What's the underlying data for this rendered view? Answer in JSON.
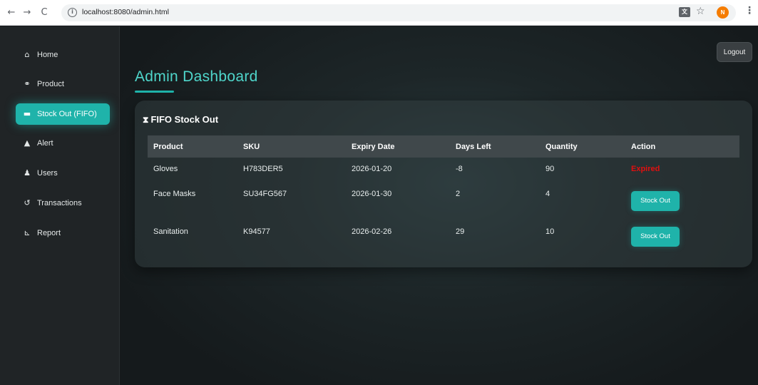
{
  "browser": {
    "url": "localhost:8080/admin.html",
    "back_glyph": "←",
    "forward_glyph": "→",
    "reload_glyph": "C",
    "info_glyph": "i",
    "translate_glyph": "文",
    "star_glyph": "☆",
    "avatar_letter": "N",
    "more_glyph": "⋮"
  },
  "sidebar": {
    "items": [
      {
        "label": "Home",
        "icon": "home-icon",
        "glyph": "⌂",
        "active": false
      },
      {
        "label": "Product",
        "icon": "product-icon",
        "glyph": "⚭",
        "active": false
      },
      {
        "label": "Stock Out (FIFO)",
        "icon": "truck-icon",
        "glyph": "▬",
        "active": true
      },
      {
        "label": "Alert",
        "icon": "warning-icon",
        "glyph": "▲",
        "active": false
      },
      {
        "label": "Users",
        "icon": "users-icon",
        "glyph": "♟",
        "active": false
      },
      {
        "label": "Transactions",
        "icon": "history-icon",
        "glyph": "↺",
        "active": false
      },
      {
        "label": "Report",
        "icon": "chart-icon",
        "glyph": "⊾",
        "active": false
      }
    ]
  },
  "header": {
    "logout_label": "Logout",
    "page_title": "Admin Dashboard"
  },
  "card": {
    "title": "FIFO Stock Out",
    "title_glyph": "⧗",
    "columns": [
      "Product",
      "SKU",
      "Expiry Date",
      "Days Left",
      "Quantity",
      "Action"
    ],
    "rows": [
      {
        "product": "Gloves",
        "sku": "H783DER5",
        "expiry": "2026-01-20",
        "days_left": "-8",
        "quantity": "90",
        "action": "Expired",
        "action_type": "status"
      },
      {
        "product": "Face Masks",
        "sku": "SU34FG567",
        "expiry": "2026-01-30",
        "days_left": "2",
        "quantity": "4",
        "action": "Stock Out",
        "action_type": "button"
      },
      {
        "product": "Sanitation",
        "sku": "K94577",
        "expiry": "2026-02-26",
        "days_left": "29",
        "quantity": "10",
        "action": "Stock Out",
        "action_type": "button"
      }
    ]
  },
  "colors": {
    "accent": "#1fb3aa",
    "title": "#4fd6cb",
    "expired": "#e01010",
    "sidebar_bg": "#202426",
    "page_bg": "#16191b"
  }
}
